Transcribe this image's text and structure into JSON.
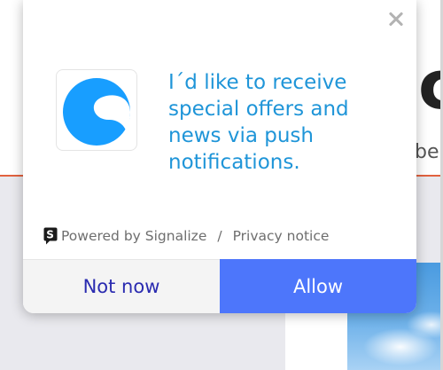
{
  "background_page": {
    "big_letter": "c",
    "small_text": "be",
    "accent_rule_color": "#e2623f"
  },
  "prompt": {
    "close_icon": "close-icon",
    "logo_icon": "shopware-logo-icon",
    "message": "I´d like to receive special offers and news via push notifications.",
    "powered_icon": "signalize-icon",
    "powered_by": "Powered by Signalize",
    "separator": "/",
    "privacy": "Privacy notice",
    "not_now_label": "Not now",
    "allow_label": "Allow",
    "colors": {
      "message": "#1f95d8",
      "allow_button": "#4d76fb",
      "not_now_text": "#2a2bb0",
      "logo": "#189eff"
    }
  }
}
